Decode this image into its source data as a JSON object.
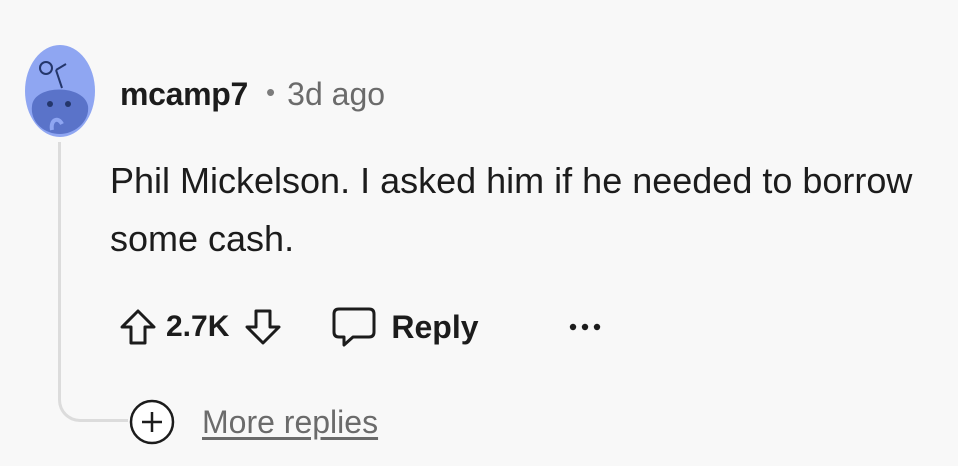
{
  "comment": {
    "username": "mcamp7",
    "separator": "•",
    "timestamp": "3d ago",
    "body": "Phil Mickelson. I asked him if he needed to borrow some cash.",
    "vote_count": "2.7K",
    "reply_label": "Reply",
    "more_replies_label": "More replies"
  },
  "colors": {
    "avatar_bg": "#8fa6f2",
    "avatar_figure": "#5a73c9",
    "thread_line": "#dcdcdc",
    "meta_text": "#6b6b6b"
  },
  "icons": {
    "avatar": "reddit-snoo-avatar",
    "upvote": "arrow-up-outline-icon",
    "downvote": "arrow-down-outline-icon",
    "reply": "speech-bubble-icon",
    "more": "ellipsis-icon",
    "expand": "plus-circle-icon"
  }
}
